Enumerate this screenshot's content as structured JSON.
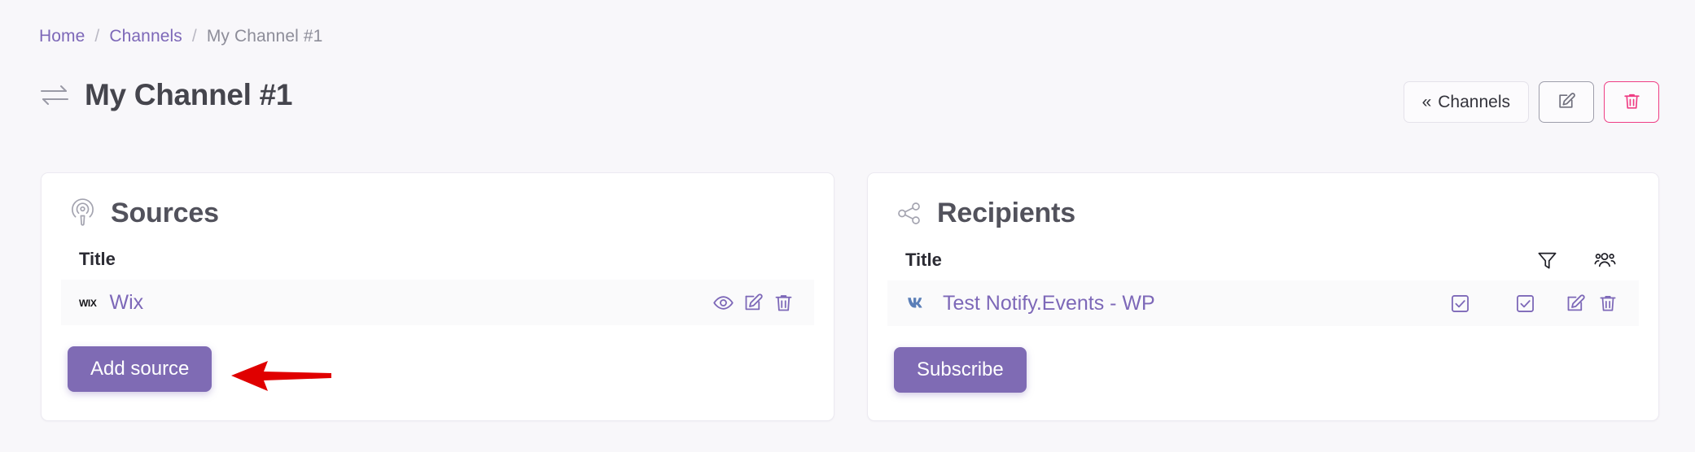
{
  "breadcrumb": {
    "items": [
      {
        "label": "Home",
        "type": "link"
      },
      {
        "label": "Channels",
        "type": "link"
      },
      {
        "label": "My Channel #1",
        "type": "current"
      }
    ],
    "separator": "/"
  },
  "header": {
    "title": "My Channel #1",
    "title_icon": "exchange-arrows-icon",
    "actions": {
      "back_label": "Channels",
      "back_chevron": "«",
      "edit_icon": "edit-pencil-icon",
      "delete_icon": "trash-icon"
    }
  },
  "colors": {
    "accent_purple": "#7f6bb4",
    "link_purple": "#7d68b8",
    "danger_pink": "#ef3d84",
    "page_background": "#f8f7fa",
    "card_background": "#ffffff",
    "row_background": "#fafafb",
    "annotation_red": "#e00000"
  },
  "cards": {
    "sources": {
      "icon": "podcast-broadcast-icon",
      "title": "Sources",
      "table": {
        "header": {
          "title": "Title"
        },
        "rows": [
          {
            "logo": "wix-logo",
            "logo_text": "wix",
            "label": "Wix",
            "actions": [
              "eye-icon",
              "edit-pencil-icon",
              "trash-icon"
            ]
          }
        ]
      },
      "primary_button": "Add source"
    },
    "recipients": {
      "icon": "share-network-icon",
      "title": "Recipients",
      "table": {
        "header": {
          "title": "Title",
          "icons": [
            "filter-funnel-icon",
            "users-group-icon"
          ]
        },
        "rows": [
          {
            "logo": "vk-logo",
            "label": "Test Notify.Events - WP",
            "checkbox_1": "checked",
            "checkbox_2": "checked",
            "actions": [
              "edit-pencil-icon",
              "trash-icon"
            ]
          }
        ]
      },
      "primary_button": "Subscribe"
    }
  },
  "annotation": {
    "type": "arrow",
    "direction": "left",
    "points_at": "Add source"
  }
}
